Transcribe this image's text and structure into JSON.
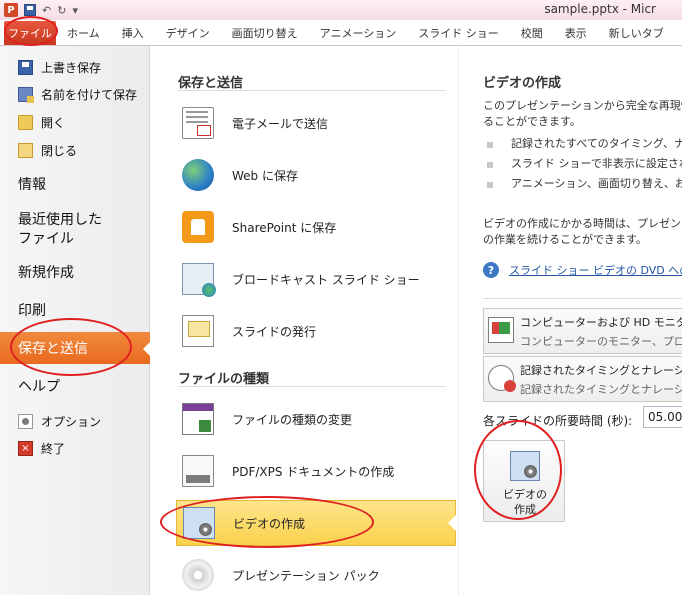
{
  "titlebar": {
    "app_icon": "P",
    "title": "sample.pptx - Micr"
  },
  "ribbon": {
    "file_tab": "ファイル",
    "tabs": [
      "ホーム",
      "挿入",
      "デザイン",
      "画面切り替え",
      "アニメーション",
      "スライド ショー",
      "校閲",
      "表示",
      "新しいタブ"
    ]
  },
  "leftnav": {
    "save": "上書き保存",
    "save_as": "名前を付けて保存",
    "open": "開く",
    "close": "閉じる",
    "info": "情報",
    "recent": "最近使用した\nファイル",
    "new": "新規作成",
    "print": "印刷",
    "save_send": "保存と送信",
    "help": "ヘルプ",
    "options": "オプション",
    "exit": "終了"
  },
  "middle": {
    "section1": "保存と送信",
    "items1": [
      "電子メールで送信",
      "Web に保存",
      "SharePoint に保存",
      "ブロードキャスト スライド ショー",
      "スライドの発行"
    ],
    "section2": "ファイルの種類",
    "items2": [
      "ファイルの種類の変更",
      "PDF/XPS ドキュメントの作成",
      "ビデオの作成",
      "プレゼンテーション パック"
    ]
  },
  "right": {
    "title": "ビデオの作成",
    "desc1": "このプレゼンテーションから完全な再現性",
    "desc2": "ることができます。",
    "bullets": [
      "記録されたすべてのタイミング、ナレ",
      "スライド ショーで非表示に設定され",
      "アニメーション、画面切り替え、およ"
    ],
    "time1": "ビデオの作成にかかる時間は、プレゼンテ",
    "time2": "の作業を続けることができます。",
    "help_link": "スライド ショー ビデオの DVD への",
    "dropdown1": {
      "line1": "コンピューターおよび HD モニター",
      "line2": "コンピューターのモニター、プロジェ"
    },
    "dropdown2": {
      "line1": "記録されたタイミングとナレーション",
      "line2": "記録されたタイミングとナレーション"
    },
    "duration_label": "各スライドの所要時間 (秒):",
    "duration_value": "05.00",
    "create_button": "ビデオの\n作成"
  },
  "colors": {
    "accent_orange": "#e96a20",
    "file_tab_red": "#c6381f",
    "highlight_yellow": "#fbd14d",
    "annotation_red": "#e02020"
  }
}
